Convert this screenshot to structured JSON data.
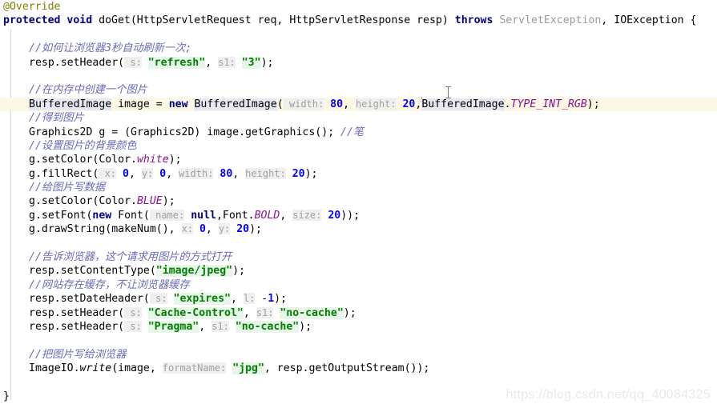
{
  "editor": {
    "language": "Java",
    "theme": "IntelliJ Light",
    "colors": {
      "background": "#ffffff",
      "keyword": "#000080",
      "string": "#008000",
      "number": "#0000ff",
      "comment": "#6a6ab8",
      "annotation": "#808000",
      "parameter_hint": "#a0a0a0",
      "static_field": "#871094",
      "greyed_text": "#9a9a9a",
      "current_line_highlight": "#fdf8e4",
      "identifier_highlight": "#e8e8f4"
    },
    "caret_line": 6,
    "caret_column_text": "20,"
  },
  "lines": [
    {
      "n": 1,
      "indent": 0,
      "tokens": [
        {
          "t": "@Override",
          "c": "anno"
        }
      ]
    },
    {
      "n": 2,
      "indent": 0,
      "tokens": [
        {
          "t": "protected",
          "c": "kw"
        },
        {
          "t": " "
        },
        {
          "t": "void",
          "c": "kw"
        },
        {
          "t": " doGet(HttpServletRequest req, HttpServletResponse resp) "
        },
        {
          "t": "throws",
          "c": "kw"
        },
        {
          "t": " "
        },
        {
          "t": "ServletException",
          "c": "greyed"
        },
        {
          "t": ", IOException {"
        }
      ]
    },
    {
      "n": 3,
      "indent": 0,
      "tokens": [
        {
          "t": ""
        }
      ]
    },
    {
      "n": 4,
      "indent": 2,
      "tokens": [
        {
          "t": "//如何让浏览器3秒自动刷新一次;",
          "c": "cmt"
        }
      ]
    },
    {
      "n": 5,
      "indent": 2,
      "tokens": [
        {
          "t": "resp.setHeader("
        },
        {
          "t": " s:",
          "c": "hint"
        },
        {
          "t": " "
        },
        {
          "t": "\"refresh\"",
          "c": "str"
        },
        {
          "t": ", "
        },
        {
          "t": "s1:",
          "c": "hint"
        },
        {
          "t": " "
        },
        {
          "t": "\"3\"",
          "c": "str"
        },
        {
          "t": ");"
        }
      ]
    },
    {
      "n": 6,
      "indent": 2,
      "tokens": [
        {
          "t": ""
        }
      ]
    },
    {
      "n": 7,
      "indent": 2,
      "tokens": [
        {
          "t": "//在内存中创建一个图片",
          "c": "cmt"
        }
      ]
    },
    {
      "n": 8,
      "indent": 2,
      "current": true,
      "tokens": [
        {
          "t": "BufferedImage",
          "c": "hl-ident"
        },
        {
          "t": " image = "
        },
        {
          "t": "new",
          "c": "kw"
        },
        {
          "t": " "
        },
        {
          "t": "BufferedImage",
          "c": "hl-ident"
        },
        {
          "t": "("
        },
        {
          "t": " width:",
          "c": "hint"
        },
        {
          "t": " "
        },
        {
          "t": "80",
          "c": "num"
        },
        {
          "t": ", "
        },
        {
          "t": "height:",
          "c": "hint"
        },
        {
          "t": " "
        },
        {
          "t": "20",
          "c": "num"
        },
        {
          "t": ","
        },
        {
          "t": "|CARET|"
        },
        {
          "t": "BufferedImage",
          "c": "hl-ident"
        },
        {
          "t": "."
        },
        {
          "t": "TYPE_INT_RGB",
          "c": "statc"
        },
        {
          "t": ");"
        }
      ]
    },
    {
      "n": 9,
      "indent": 2,
      "tokens": [
        {
          "t": "//得到图片",
          "c": "cmt"
        }
      ]
    },
    {
      "n": 10,
      "indent": 2,
      "tokens": [
        {
          "t": "Graphics2D g = (Graphics2D) image.getGraphics(); "
        },
        {
          "t": "//笔",
          "c": "cmt"
        }
      ]
    },
    {
      "n": 11,
      "indent": 2,
      "tokens": [
        {
          "t": "//设置图片的背景颜色",
          "c": "cmt"
        }
      ]
    },
    {
      "n": 12,
      "indent": 2,
      "tokens": [
        {
          "t": "g.setColor(Color."
        },
        {
          "t": "white",
          "c": "field"
        },
        {
          "t": ");"
        }
      ]
    },
    {
      "n": 13,
      "indent": 2,
      "tokens": [
        {
          "t": "g.fillRect("
        },
        {
          "t": " x:",
          "c": "hint"
        },
        {
          "t": " "
        },
        {
          "t": "0",
          "c": "num"
        },
        {
          "t": ", "
        },
        {
          "t": "y:",
          "c": "hint"
        },
        {
          "t": " "
        },
        {
          "t": "0",
          "c": "num"
        },
        {
          "t": ", "
        },
        {
          "t": "width:",
          "c": "hint"
        },
        {
          "t": " "
        },
        {
          "t": "80",
          "c": "num"
        },
        {
          "t": ", "
        },
        {
          "t": "height:",
          "c": "hint"
        },
        {
          "t": " "
        },
        {
          "t": "20",
          "c": "num"
        },
        {
          "t": ");"
        }
      ]
    },
    {
      "n": 14,
      "indent": 2,
      "tokens": [
        {
          "t": "//给图片写数据",
          "c": "cmt"
        }
      ]
    },
    {
      "n": 15,
      "indent": 2,
      "tokens": [
        {
          "t": "g.setColor(Color."
        },
        {
          "t": "BLUE",
          "c": "statc"
        },
        {
          "t": ");"
        }
      ]
    },
    {
      "n": 16,
      "indent": 2,
      "tokens": [
        {
          "t": "g.setFont("
        },
        {
          "t": "new",
          "c": "kw"
        },
        {
          "t": " Font("
        },
        {
          "t": " name:",
          "c": "hint"
        },
        {
          "t": " "
        },
        {
          "t": "null",
          "c": "kw"
        },
        {
          "t": ",Font."
        },
        {
          "t": "BOLD",
          "c": "statc"
        },
        {
          "t": ", "
        },
        {
          "t": "size:",
          "c": "hint"
        },
        {
          "t": " "
        },
        {
          "t": "20",
          "c": "num"
        },
        {
          "t": "));"
        }
      ]
    },
    {
      "n": 17,
      "indent": 2,
      "tokens": [
        {
          "t": "g.drawString(makeNum(), "
        },
        {
          "t": "x:",
          "c": "hint"
        },
        {
          "t": " "
        },
        {
          "t": "0",
          "c": "num"
        },
        {
          "t": ", "
        },
        {
          "t": "y:",
          "c": "hint"
        },
        {
          "t": " "
        },
        {
          "t": "20",
          "c": "num"
        },
        {
          "t": ");"
        }
      ]
    },
    {
      "n": 18,
      "indent": 2,
      "tokens": [
        {
          "t": ""
        }
      ]
    },
    {
      "n": 19,
      "indent": 2,
      "tokens": [
        {
          "t": "//告诉浏览器，这个请求用图片的方式打开",
          "c": "cmt"
        }
      ]
    },
    {
      "n": 20,
      "indent": 2,
      "tokens": [
        {
          "t": "resp.setContentType("
        },
        {
          "t": "\"image/jpeg\"",
          "c": "str"
        },
        {
          "t": ");"
        }
      ]
    },
    {
      "n": 21,
      "indent": 2,
      "tokens": [
        {
          "t": "//网站存在缓存，不让浏览器缓存",
          "c": "cmt"
        }
      ]
    },
    {
      "n": 22,
      "indent": 2,
      "tokens": [
        {
          "t": "resp.setDateHeader("
        },
        {
          "t": " s:",
          "c": "hint"
        },
        {
          "t": " "
        },
        {
          "t": "\"expires\"",
          "c": "str"
        },
        {
          "t": ", "
        },
        {
          "t": "l:",
          "c": "hint"
        },
        {
          "t": " "
        },
        {
          "t": "-",
          "c": "punct"
        },
        {
          "t": "1",
          "c": "num"
        },
        {
          "t": ");"
        }
      ]
    },
    {
      "n": 23,
      "indent": 2,
      "tokens": [
        {
          "t": "resp.setHeader("
        },
        {
          "t": " s:",
          "c": "hint"
        },
        {
          "t": " "
        },
        {
          "t": "\"Cache-Control\"",
          "c": "str"
        },
        {
          "t": ", "
        },
        {
          "t": "s1:",
          "c": "hint"
        },
        {
          "t": " "
        },
        {
          "t": "\"no-cache\"",
          "c": "str"
        },
        {
          "t": ");"
        }
      ]
    },
    {
      "n": 24,
      "indent": 2,
      "tokens": [
        {
          "t": "resp.setHeader("
        },
        {
          "t": " s:",
          "c": "hint"
        },
        {
          "t": " "
        },
        {
          "t": "\"Pragma\"",
          "c": "str"
        },
        {
          "t": ", "
        },
        {
          "t": "s1:",
          "c": "hint"
        },
        {
          "t": " "
        },
        {
          "t": "\"no-cache\"",
          "c": "str"
        },
        {
          "t": ");"
        }
      ]
    },
    {
      "n": 25,
      "indent": 2,
      "tokens": [
        {
          "t": ""
        }
      ]
    },
    {
      "n": 26,
      "indent": 2,
      "tokens": [
        {
          "t": "//把图片写给浏览器",
          "c": "cmt"
        }
      ]
    },
    {
      "n": 27,
      "indent": 2,
      "tokens": [
        {
          "t": "ImageIO."
        },
        {
          "t": "write",
          "c": "meth"
        },
        {
          "t": "(image, "
        },
        {
          "t": "formatName:",
          "c": "hint"
        },
        {
          "t": " "
        },
        {
          "t": "\"jpg\"",
          "c": "str"
        },
        {
          "t": ", resp.getOutputStream());"
        }
      ]
    },
    {
      "n": 28,
      "indent": 2,
      "tokens": [
        {
          "t": ""
        }
      ]
    },
    {
      "n": 29,
      "indent": 0,
      "tokens": [
        {
          "t": "}"
        }
      ]
    }
  ],
  "watermark": {
    "text": "https://blog.csdn.net/qq_40084325"
  }
}
